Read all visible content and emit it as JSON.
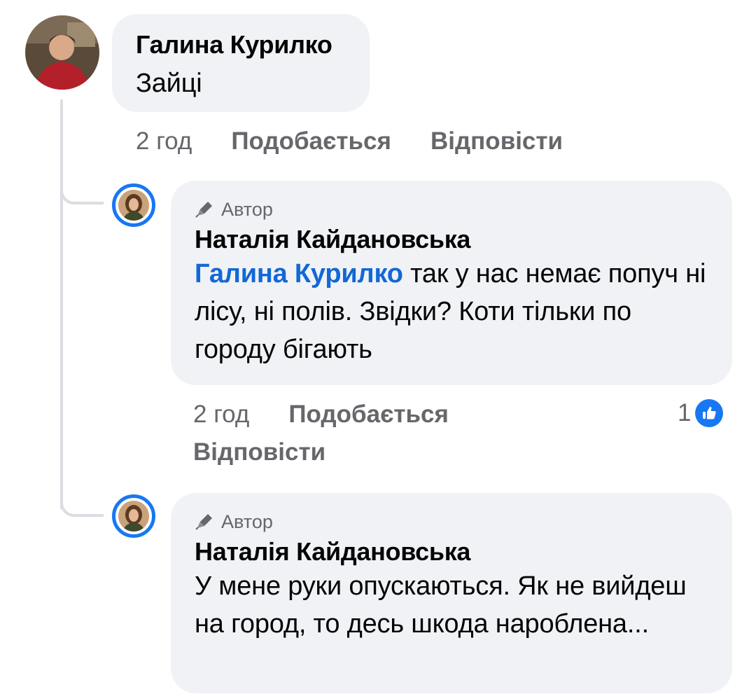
{
  "comments": [
    {
      "author": "Галина Курилко",
      "text": "Зайці",
      "time": "2 год",
      "like_label": "Подобається",
      "reply_label": "Відповісти"
    }
  ],
  "replies": [
    {
      "badge": "Автор",
      "author": "Наталія Кайдановська",
      "mention": "Галина Курилко",
      "text": " так у нас немає попуч ні лісу, ні полів. Звідки? Коти тільки по городу бігають",
      "time": "2 год",
      "like_label": "Подобається",
      "reply_label": "Відповісти",
      "reaction_count": "1"
    },
    {
      "badge": "Автор",
      "author": "Наталія Кайдановська",
      "text": "У мене руки опускаються. Як не вийдеш на город, то десь шкода наробленa..."
    }
  ],
  "colors": {
    "accent": "#1877f2",
    "mention": "#1268d6",
    "bubble": "#f0f2f5",
    "secondary_text": "#65676b"
  }
}
